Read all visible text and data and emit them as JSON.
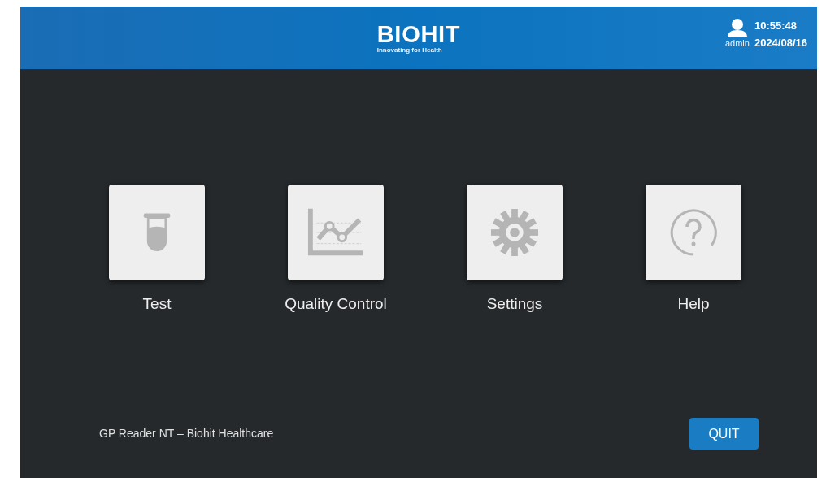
{
  "header": {
    "logo": "BIOHIT",
    "tagline": "Innovating for Health",
    "user": "admin",
    "time": "10:55:48",
    "date": "2024/08/16"
  },
  "menu": [
    {
      "kind": "test",
      "label": "Test"
    },
    {
      "kind": "quality",
      "label": "Quality Control"
    },
    {
      "kind": "settings",
      "label": "Settings"
    },
    {
      "kind": "help",
      "label": "Help"
    }
  ],
  "footer": {
    "text": "GP Reader NT – Biohit Healthcare",
    "quit": "QUIT"
  }
}
